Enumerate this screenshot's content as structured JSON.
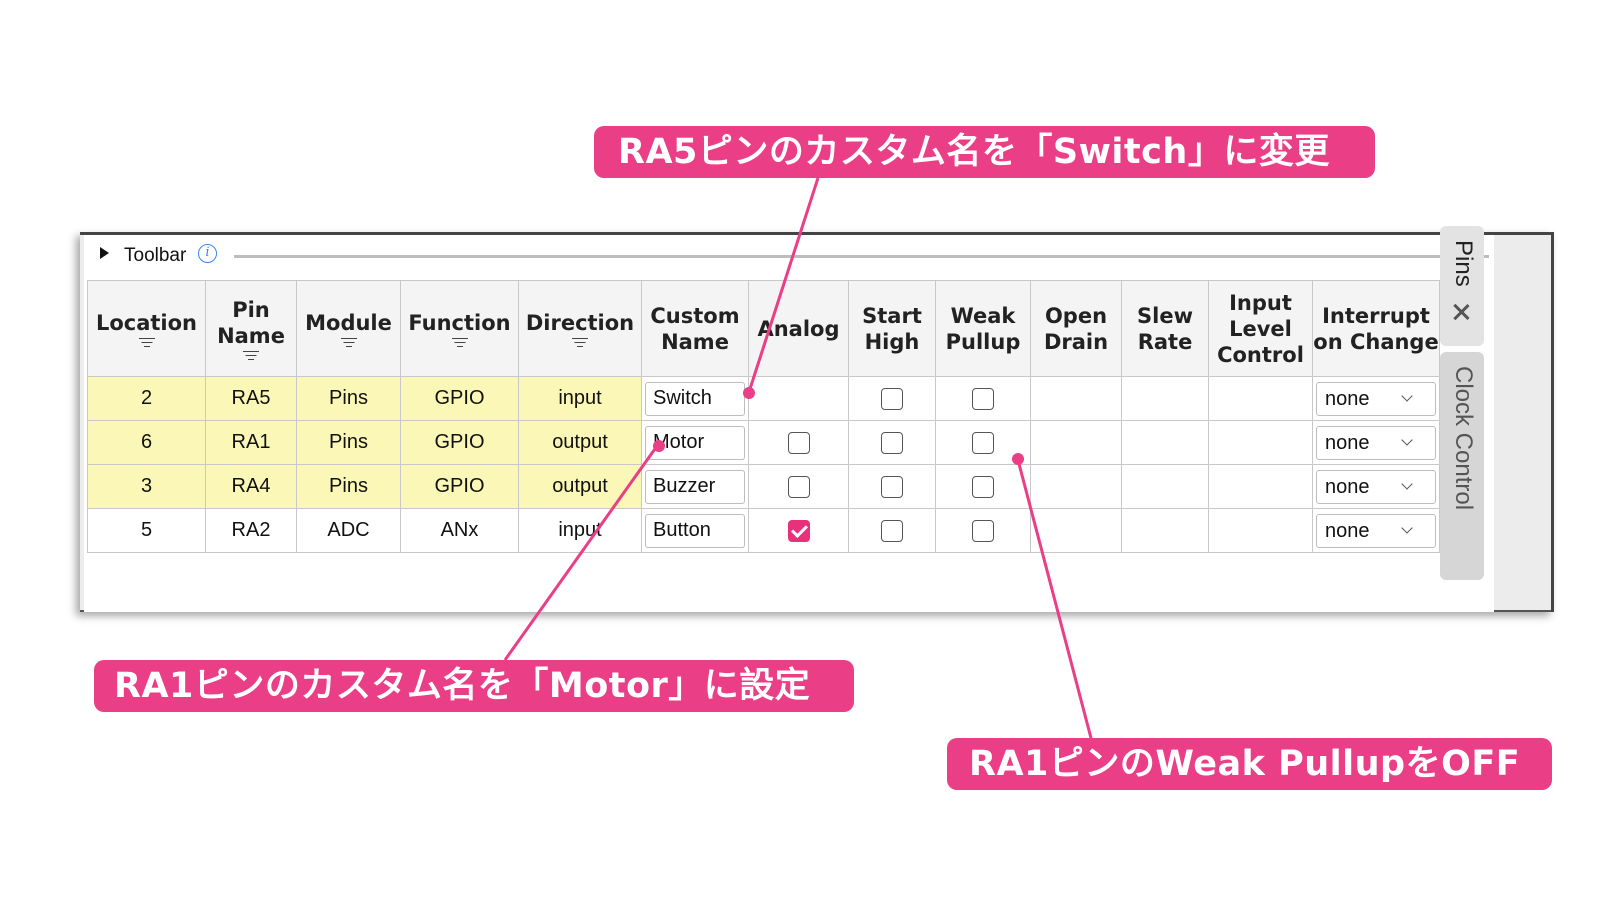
{
  "toolbar": {
    "label": "Toolbar",
    "info_icon": "info-icon"
  },
  "columns": [
    {
      "label": "Location",
      "sortable": true
    },
    {
      "label": "Pin Name",
      "sortable": true
    },
    {
      "label": "Module",
      "sortable": true
    },
    {
      "label": "Function",
      "sortable": true
    },
    {
      "label": "Direction",
      "sortable": true
    },
    {
      "label": "Custom Name",
      "sortable": false
    },
    {
      "label": "Analog",
      "sortable": false
    },
    {
      "label": "Start High",
      "sortable": false
    },
    {
      "label": "Weak Pullup",
      "sortable": false
    },
    {
      "label": "Open Drain",
      "sortable": false
    },
    {
      "label": "Slew Rate",
      "sortable": false
    },
    {
      "label": "Input Level Control",
      "sortable": false
    },
    {
      "label": "Interrupt on Change",
      "sortable": false
    }
  ],
  "rows": [
    {
      "location": "2",
      "pin": "RA5",
      "module": "Pins",
      "function": "GPIO",
      "direction": "input",
      "custom_name": "Switch",
      "analog": null,
      "start_high": false,
      "weak_pullup": false,
      "ioc": "none",
      "highlight": true
    },
    {
      "location": "6",
      "pin": "RA1",
      "module": "Pins",
      "function": "GPIO",
      "direction": "output",
      "custom_name": "Motor",
      "analog": false,
      "start_high": false,
      "weak_pullup": false,
      "ioc": "none",
      "highlight": true
    },
    {
      "location": "3",
      "pin": "RA4",
      "module": "Pins",
      "function": "GPIO",
      "direction": "output",
      "custom_name": "Buzzer",
      "analog": false,
      "start_high": false,
      "weak_pullup": false,
      "ioc": "none",
      "highlight": true
    },
    {
      "location": "5",
      "pin": "RA2",
      "module": "ADC",
      "function": "ANx",
      "direction": "input",
      "custom_name": "Button",
      "analog": true,
      "start_high": false,
      "weak_pullup": false,
      "ioc": "none",
      "highlight": false
    }
  ],
  "side_tabs": {
    "pins": "Pins",
    "clock": "Clock Control"
  },
  "callouts": {
    "ra5_switch": "RA5ピンのカスタム名を「Switch」に変更",
    "ra1_motor": "RA1ピンのカスタム名を「Motor」に設定",
    "ra1_pullup": "RA1ピンのWeak PullupをOFF"
  },
  "colors": {
    "accent": "#ea3e86",
    "highlight_row": "#fbf7b6",
    "checkbox_checked": "#e8317a"
  }
}
